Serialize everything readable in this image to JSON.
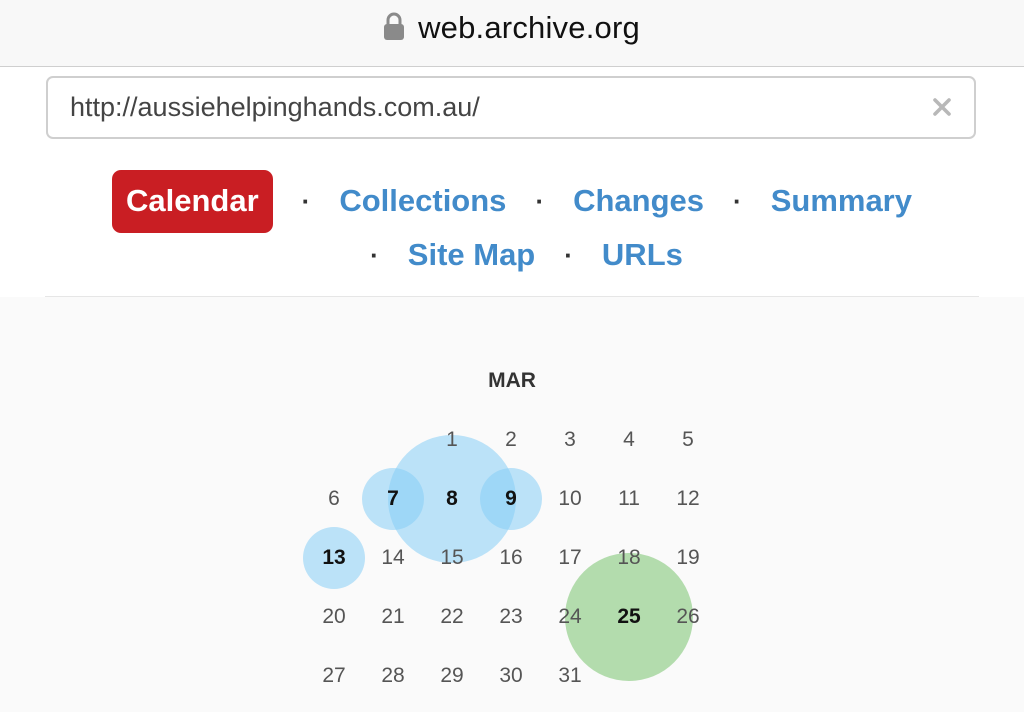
{
  "browser": {
    "domain": "web.archive.org",
    "lock_icon": "lock-icon"
  },
  "search": {
    "value": "http://aussiehelpinghands.com.au/",
    "clear_icon": "close-icon"
  },
  "nav": {
    "calendar": "Calendar",
    "collections": "Collections",
    "changes": "Changes",
    "summary": "Summary",
    "site_map": "Site Map",
    "urls": "URLs",
    "separator": "·"
  },
  "colors": {
    "active_tab": "#c91e23",
    "link": "#428bca",
    "capture_blue": "#87cdf5",
    "capture_green": "#90cd88"
  },
  "calendar": {
    "month": "MAR",
    "weeks": [
      [
        "",
        "",
        "1",
        "2",
        "3",
        "4",
        "5"
      ],
      [
        "6",
        "7",
        "8",
        "9",
        "10",
        "11",
        "12"
      ],
      [
        "13",
        "14",
        "15",
        "16",
        "17",
        "18",
        "19"
      ],
      [
        "20",
        "21",
        "22",
        "23",
        "24",
        "25",
        "26"
      ],
      [
        "27",
        "28",
        "29",
        "30",
        "31",
        "",
        ""
      ]
    ],
    "captured_days": [
      {
        "day": "7",
        "color": "blue",
        "relative_count": 1
      },
      {
        "day": "8",
        "color": "blue",
        "relative_count": 4
      },
      {
        "day": "9",
        "color": "blue",
        "relative_count": 1
      },
      {
        "day": "13",
        "color": "blue",
        "relative_count": 1
      },
      {
        "day": "25",
        "color": "green",
        "relative_count": 4
      }
    ]
  }
}
